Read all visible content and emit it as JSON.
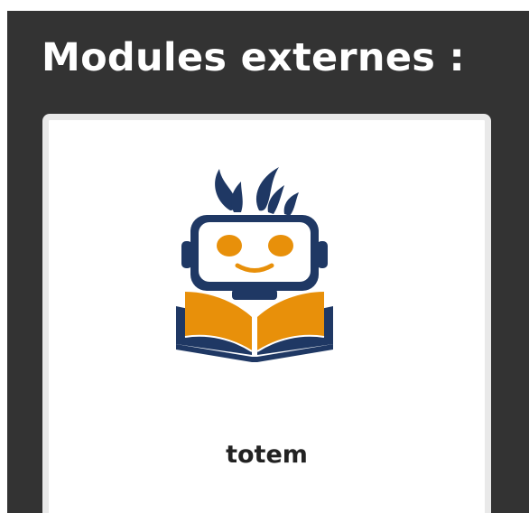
{
  "section": {
    "title": "Modules externes :"
  },
  "modules": [
    {
      "name": "totem",
      "icon": "robot-reading-book-icon",
      "colors": {
        "navy": "#1f3864",
        "orange": "#e8900a"
      }
    }
  ]
}
